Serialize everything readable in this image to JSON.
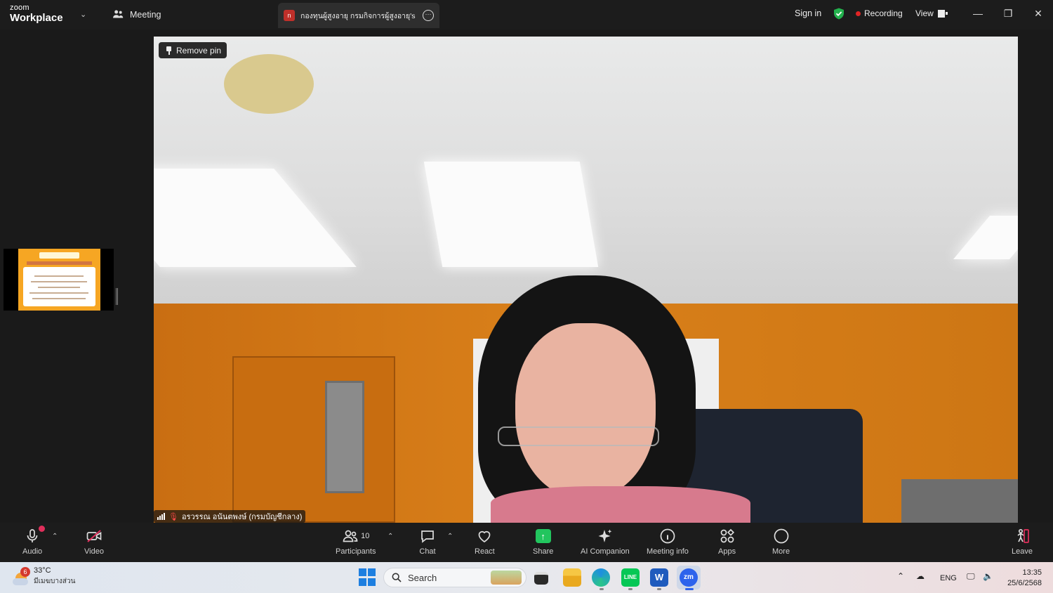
{
  "titlebar": {
    "logo_line1": "zoom",
    "logo_line2": "Workplace",
    "meeting_label": "Meeting",
    "tab_icon": "n",
    "tab_title": "กองทุนผู้สูงอายุ กรมกิจการผู้สูงอายุ's sc",
    "sign_in": "Sign in",
    "recording": "Recording",
    "view": "View",
    "minimize": "—",
    "restore": "❐",
    "close": "✕"
  },
  "video": {
    "remove_pin": "Remove pin",
    "participant_name": "อรวรรณ อนันตพงษ์ (กรมบัญชีกลาง)"
  },
  "toolbar": {
    "audio": "Audio",
    "video": "Video",
    "participants": "Participants",
    "participant_count": "10",
    "chat": "Chat",
    "react": "React",
    "share": "Share",
    "ai_companion": "AI Companion",
    "meeting_info": "Meeting info",
    "apps": "Apps",
    "more": "More",
    "leave": "Leave",
    "accent_color": "#22c55e",
    "muted_color": "#e02f5b"
  },
  "taskbar": {
    "weather_temp": "33°C",
    "weather_desc": "มีเมฆบางส่วน",
    "weather_badge": "6",
    "search_placeholder": "Search",
    "language": "ENG",
    "time": "13:35",
    "date": "25/6/2568"
  }
}
